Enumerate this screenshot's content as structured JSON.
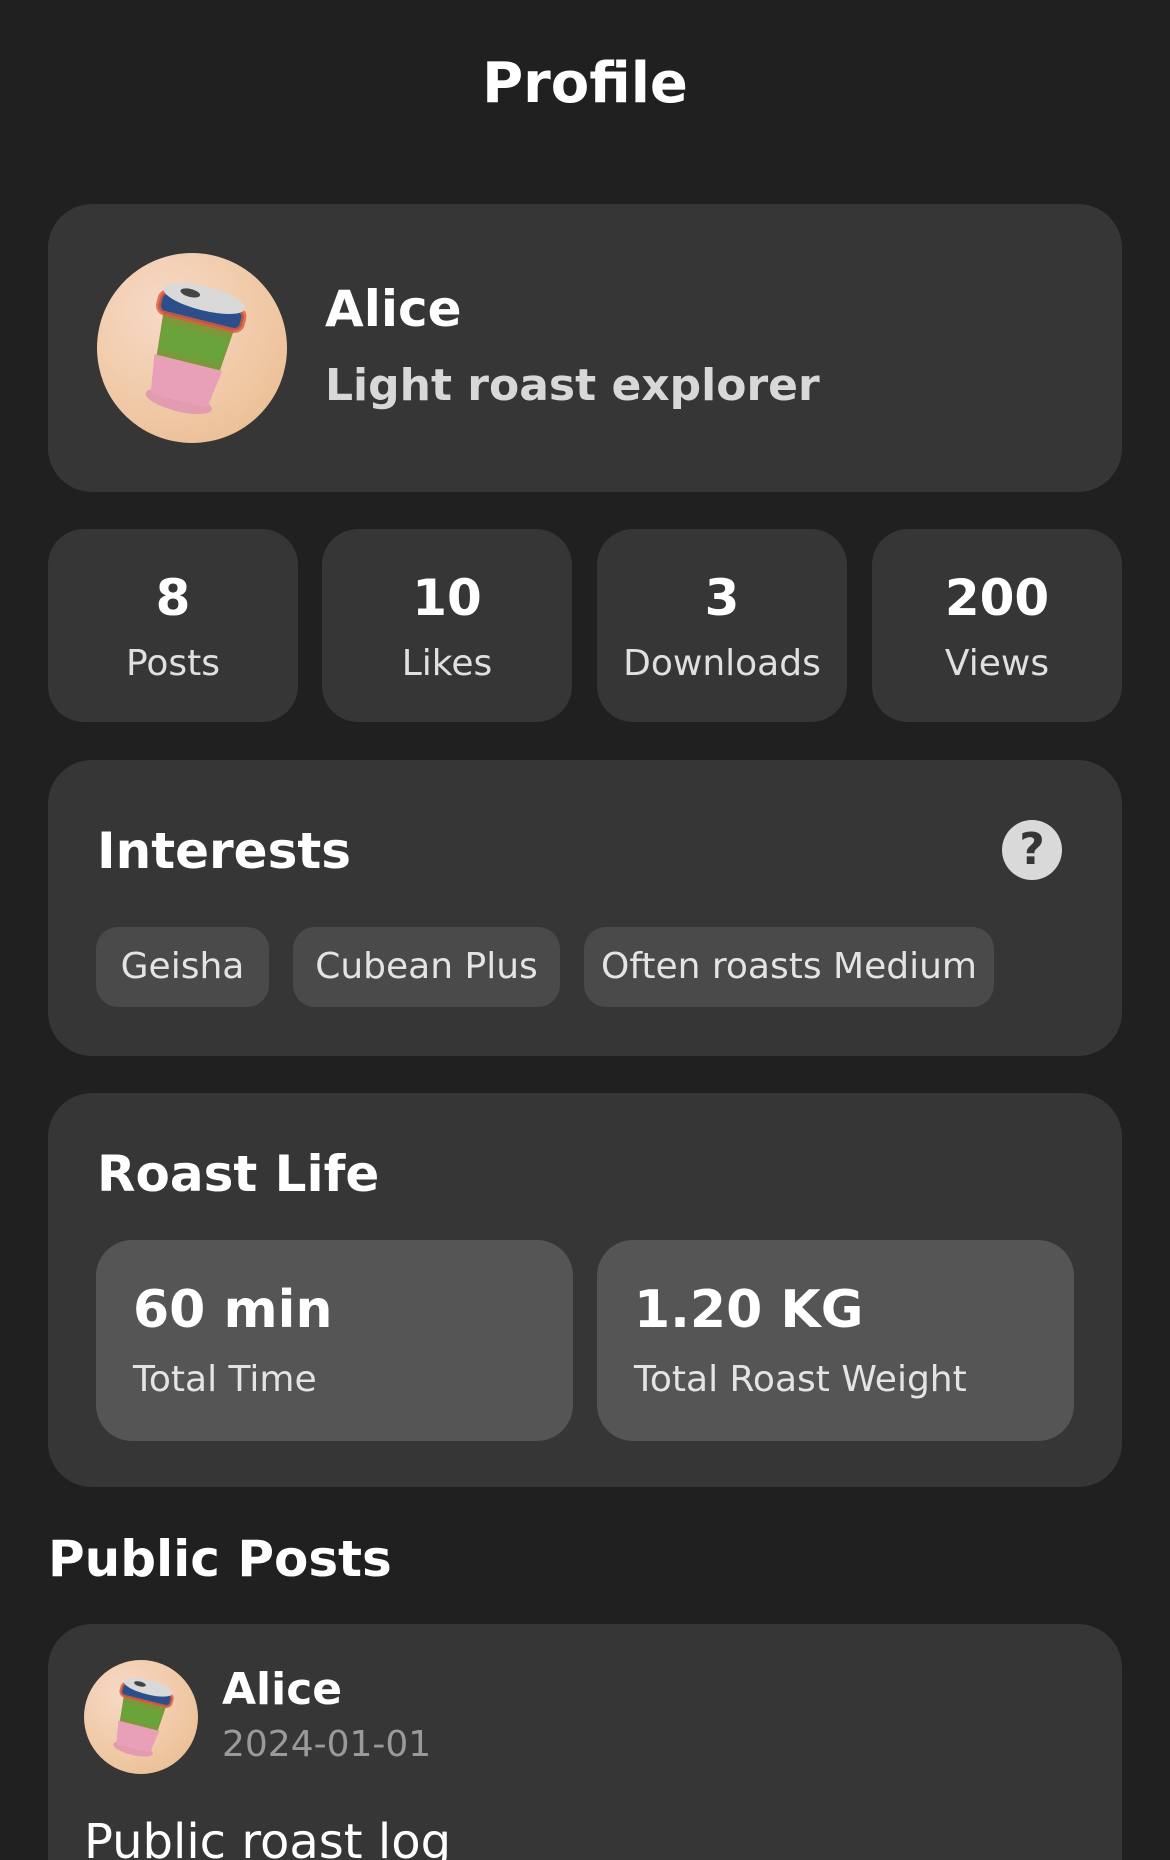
{
  "header": {
    "title": "Profile"
  },
  "profile": {
    "name": "Alice",
    "bio": "Light roast explorer",
    "avatar_icon": "coffee-cup-icon"
  },
  "stats": [
    {
      "value": "8",
      "label": "Posts"
    },
    {
      "value": "10",
      "label": "Likes"
    },
    {
      "value": "3",
      "label": "Downloads"
    },
    {
      "value": "200",
      "label": "Views"
    }
  ],
  "interests": {
    "title": "Interests",
    "help_icon": "question-mark-icon",
    "help_glyph": "?",
    "tags": [
      "Geisha",
      "Cubean Plus",
      "Often roasts Medium"
    ]
  },
  "roast_life": {
    "title": "Roast Life",
    "total_time": {
      "value": "60 min",
      "label": "Total Time"
    },
    "total_weight": {
      "value": "1.20 KG",
      "label": "Total Roast Weight"
    }
  },
  "public_posts": {
    "title": "Public Posts",
    "items": [
      {
        "author": "Alice",
        "date": "2024-01-01",
        "title": "Public roast log"
      }
    ]
  },
  "colors": {
    "background": "#202020",
    "card": "#363636",
    "tile": "#555555",
    "tag": "#4a4a4a"
  }
}
